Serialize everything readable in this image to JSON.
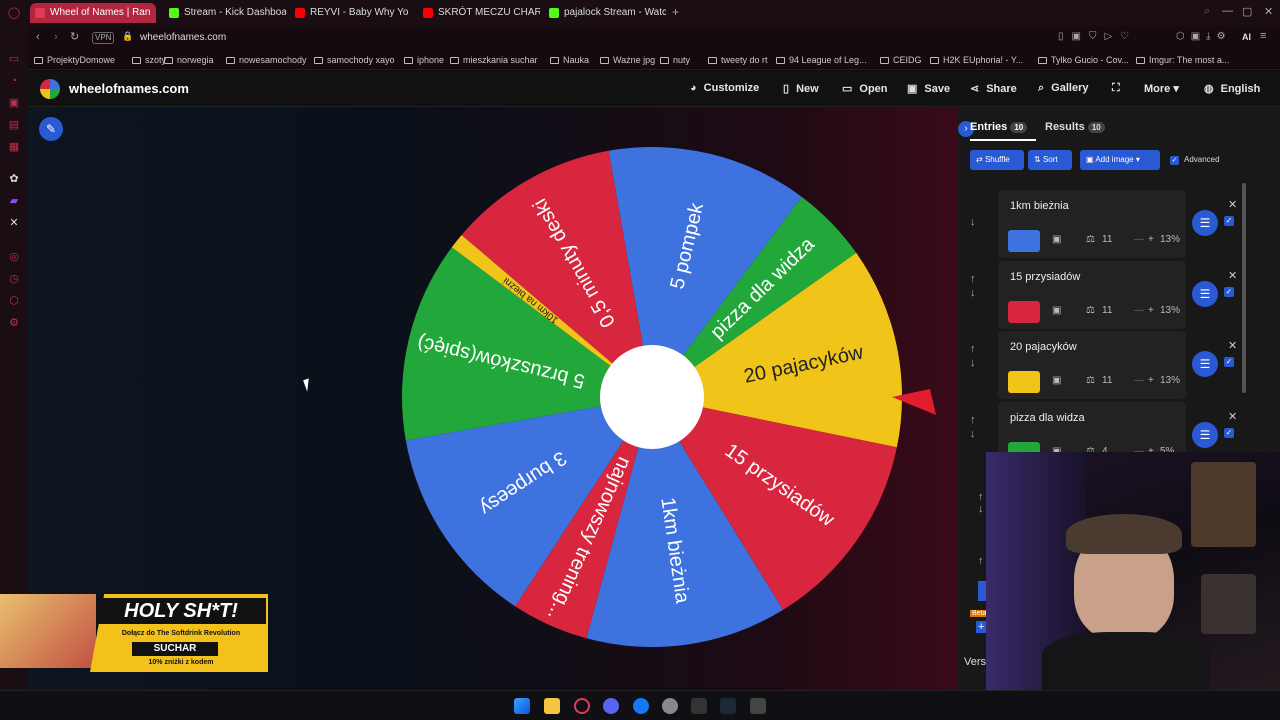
{
  "browser": {
    "tabs": [
      {
        "label": "Wheel of Names | Ran",
        "color": "#e23b54"
      },
      {
        "label": "Stream - Kick Dashboard",
        "color": "#53fc18"
      },
      {
        "label": "REYVI - Baby Why Yo",
        "color": "#ff0000"
      },
      {
        "label": "SKRÓT MECZU CHARYTA",
        "color": "#ff0000"
      },
      {
        "label": "pajalock Stream - Watch L",
        "color": "#53fc18"
      }
    ],
    "vpn": "VPN",
    "url": "wheelofnames.com",
    "ai_label": "AI",
    "bookmarks": [
      "ProjektyDomowe",
      "szoty",
      "norwegia",
      "nowesamochody",
      "samochody xayo",
      "iphone",
      "mieszkania suchar",
      "Nauka",
      "Ważne jpg",
      "nuty",
      "tweety do rt",
      "94 League of Leg...",
      "CEIDG",
      "H2K EUphoria! - Y...",
      "Tylko Gucio - Cov...",
      "Imgur: The most a..."
    ]
  },
  "site": {
    "brand": "wheelofnames.com",
    "nav": [
      "Customize",
      "New",
      "Open",
      "Save",
      "Share",
      "Gallery",
      "More",
      "English"
    ]
  },
  "wheel": {
    "slices": [
      {
        "label": "5 pompek",
        "color": "#3e72de",
        "share": 13
      },
      {
        "label": "pizza dla widza",
        "color": "#22a83a",
        "share": 5
      },
      {
        "label": "20 pajacyków",
        "color": "#f0c419",
        "share": 13
      },
      {
        "label": "15 przysiadów",
        "color": "#d7263d",
        "share": 13
      },
      {
        "label": "1km bieżnia",
        "color": "#3e72de",
        "share": 13
      },
      {
        "label": "najnowszy trening...",
        "color": "#d7263d",
        "share": 5
      },
      {
        "label": "3 burpeesy",
        "color": "#3e72de",
        "share": 13
      },
      {
        "label": "5 brzuszków(spięć)",
        "color": "#22a83a",
        "share": 13
      },
      {
        "label": "10km na bieżni",
        "color": "#f0c419",
        "share": 1
      },
      {
        "label": "0,5 minuty deski",
        "color": "#d7263d",
        "share": 11
      }
    ]
  },
  "panel": {
    "tabs": {
      "entries": "Entries",
      "entries_count": "10",
      "results": "Results",
      "results_count": "10"
    },
    "toolbar": {
      "shuffle": "Shuffle",
      "sort": "Sort",
      "add_image": "Add image",
      "advanced": "Advanced"
    },
    "entries": [
      {
        "name": "1km bieżnia",
        "color": "#3e72de",
        "weight": "11",
        "percent": "13%"
      },
      {
        "name": "15 przysiadów",
        "color": "#d7263d",
        "weight": "11",
        "percent": "13%"
      },
      {
        "name": "20 pajacyków",
        "color": "#f0c419",
        "weight": "11",
        "percent": "13%"
      },
      {
        "name": "pizza dla widza",
        "color": "#22a83a",
        "weight": "4",
        "percent": "5%"
      }
    ],
    "beta": "Beta",
    "version": "Vers"
  },
  "ad": {
    "headline": "HOLY SH*T!",
    "line1": "Dołącz do The Softdrink Revolution",
    "code": "SUCHAR",
    "line2": "10% zniżki z kodem"
  }
}
